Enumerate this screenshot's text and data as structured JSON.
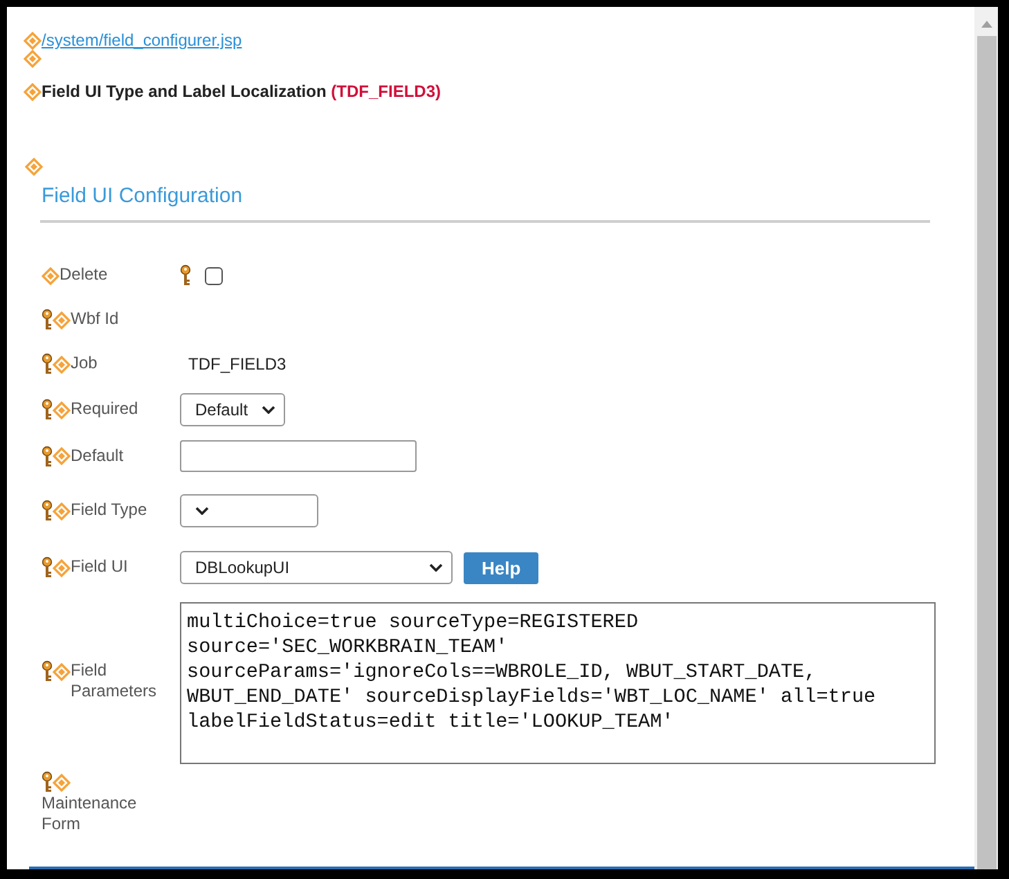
{
  "header": {
    "link": "/system/field_configurer.jsp",
    "title": "Field UI Type and Label Localization",
    "title_code": "(TDF_FIELD3)"
  },
  "section": {
    "title": "Field UI Configuration"
  },
  "rows": [
    {
      "label": "Delete",
      "kind": "checkbox",
      "checked": false
    },
    {
      "label": "Wbf Id",
      "kind": "empty"
    },
    {
      "label": "Job",
      "kind": "text",
      "value": "TDF_FIELD3"
    },
    {
      "label": "Required",
      "kind": "select",
      "value": "Default"
    },
    {
      "label": "Default",
      "kind": "input"
    },
    {
      "label": "Field Type",
      "kind": "select"
    },
    {
      "label": "Field UI",
      "kind": "select_button",
      "value": "DBLookupUI",
      "button": "Help"
    },
    {
      "label": "Field Parameters",
      "kind": "textarea",
      "value": "multiChoice=true sourceType=REGISTERED source='SEC_WORKBRAIN_TEAM' sourceParams='ignoreCols==WBROLE_ID, WBUT_START_DATE, WBUT_END_DATE' sourceDisplayFields='WBT_LOC_NAME' all=true labelFieldStatus=edit title='LOOKUP_TEAM'"
    },
    {
      "label": "Maintenance Form",
      "kind": "empty"
    }
  ]
}
